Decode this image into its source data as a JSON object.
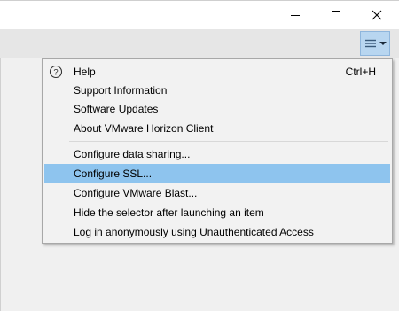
{
  "window": {
    "controls": [
      "minimize-icon",
      "maximize-icon",
      "close-icon"
    ]
  },
  "toolbar": {
    "menu_button_icon": "hamburger-icon",
    "dropdown_icon": "caret-down-icon",
    "menu_button_color": "#b8d6f0"
  },
  "menu": {
    "help": {
      "label": "Help",
      "shortcut": "Ctrl+H",
      "icon": "help-circle-icon"
    },
    "support": {
      "label": "Support Information"
    },
    "updates": {
      "label": "Software Updates"
    },
    "about": {
      "label": "About VMware Horizon Client"
    },
    "data_sharing": {
      "label": "Configure data sharing..."
    },
    "ssl": {
      "label": "Configure SSL..."
    },
    "blast": {
      "label": "Configure VMware Blast..."
    },
    "hide_selector": {
      "label": "Hide the selector after launching an item"
    },
    "anonymous": {
      "label": "Log in anonymously using Unauthenticated Access"
    },
    "selected_color": "#8ec4ee"
  }
}
